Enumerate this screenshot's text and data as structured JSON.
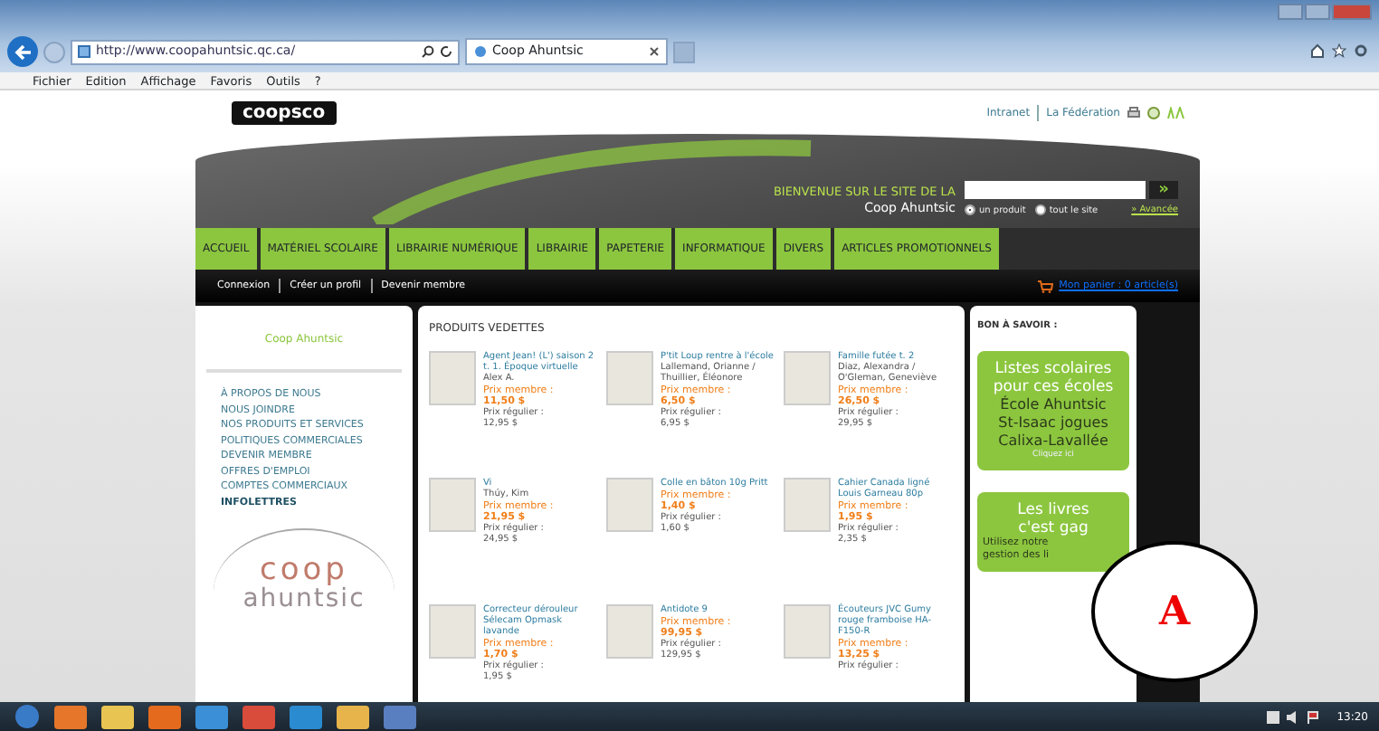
{
  "browser": {
    "address": "http://www.coopahuntsic.qc.ca/",
    "tab": "Coop Ahuntsic",
    "menu": [
      "Fichier",
      "Edition",
      "Affichage",
      "Favoris",
      "Outils",
      "?"
    ]
  },
  "header": {
    "logo": "coopsco",
    "links": [
      "Intranet",
      "La Fédération"
    ],
    "welcome": "BIENVENUE SUR LE SITE DE LA",
    "store": "Coop Ahuntsic",
    "search": {
      "go": "»",
      "scopes": [
        {
          "label": "un produit",
          "selected": true
        },
        {
          "label": "tout le site",
          "selected": false
        }
      ],
      "advanced": "» Avancée"
    }
  },
  "nav": [
    "ACCUEIL",
    "MATÉRIEL SCOLAIRE",
    "LIBRAIRIE NUMÉRIQUE",
    "LIBRAIRIE",
    "PAPETERIE",
    "INFORMATIQUE",
    "DIVERS",
    "ARTICLES PROMOTIONNELS"
  ],
  "account_bar": {
    "links": [
      "Connexion",
      "Créer un profil",
      "Devenir membre"
    ],
    "cart": "Mon panier : 0 article(s)"
  },
  "sidebar": {
    "title": "Coop Ahuntsic",
    "items": [
      {
        "label": "À PROPOS DE NOUS",
        "selected": false
      },
      {
        "label": "NOUS JOINDRE",
        "selected": false
      },
      {
        "label": "NOS PRODUITS ET SERVICES",
        "selected": false
      },
      {
        "label": "POLITIQUES COMMERCIALES",
        "selected": false
      },
      {
        "label": "DEVENIR MEMBRE",
        "selected": false
      },
      {
        "label": "OFFRES D'EMPLOI",
        "selected": false
      },
      {
        "label": "COMPTES COMMERCIAUX",
        "selected": false
      },
      {
        "label": "INFOLETTRES",
        "selected": true
      }
    ],
    "logo": [
      "coop",
      "ahuntsic"
    ]
  },
  "products": {
    "title": "PRODUITS VEDETTES",
    "items": [
      {
        "name": "Agent Jean! (L') saison 2 t. 1. Époque virtuelle",
        "author": "Alex A.",
        "member_label": "Prix membre :",
        "member_price": "11,50 $",
        "regular_label": "Prix régulier :",
        "regular_price": "12,95 $"
      },
      {
        "name": "P'tit Loup rentre à l'école",
        "author": "Lallemand, Orianne / Thuillier, Éléonore",
        "member_label": "Prix membre :",
        "member_price": "6,50 $",
        "regular_label": "Prix régulier :",
        "regular_price": "6,95 $"
      },
      {
        "name": "Famille futée t. 2",
        "author": "Diaz, Alexandra / O'Gleman, Geneviève",
        "member_label": "Prix membre :",
        "member_price": "26,50 $",
        "regular_label": "Prix régulier :",
        "regular_price": "29,95 $"
      },
      {
        "name": "Vi",
        "author": "Thúy, Kim",
        "member_label": "Prix membre :",
        "member_price": "21,95 $",
        "regular_label": "Prix régulier :",
        "regular_price": "24,95 $"
      },
      {
        "name": "Colle en bâton 10g Pritt",
        "member_label": "Prix membre :",
        "member_price": "1,40 $",
        "regular_label": "Prix régulier :",
        "regular_price": "1,60 $"
      },
      {
        "name": "Cahier Canada ligné Louis Garneau 80p",
        "member_label": "Prix membre :",
        "member_price": "1,95 $",
        "regular_label": "Prix régulier :",
        "regular_price": "2,35 $"
      },
      {
        "name": "Correcteur dérouleur Sélecam Opmask lavande",
        "member_label": "Prix membre :",
        "member_price": "1,70 $",
        "regular_label": "Prix régulier :",
        "regular_price": "1,95 $"
      },
      {
        "name": "Antidote 9",
        "member_label": "Prix membre :",
        "member_price": "99,95 $",
        "regular_label": "Prix régulier :",
        "regular_price": "129,95 $"
      },
      {
        "name": "Écouteurs JVC Gumy rouge framboise HA-F150-R",
        "member_label": "Prix membre :",
        "member_price": "13,25 $",
        "regular_label": "Prix régulier :"
      }
    ]
  },
  "info": {
    "title": "BON À SAVOIR :",
    "promos": [
      {
        "headline": [
          "Listes scolaires",
          "pour ces écoles"
        ],
        "lines": [
          "École Ahuntsic",
          "St-Isaac jogues",
          "Calixa-Lavallée"
        ],
        "link": "Cliquez ici"
      },
      {
        "headline": [
          "Les livres",
          "c'est gag"
        ],
        "lines": [
          "Utilisez notre",
          "gestion des li"
        ]
      }
    ]
  },
  "callout": {
    "label": "A"
  },
  "taskbar": {
    "clock": "13:20"
  }
}
